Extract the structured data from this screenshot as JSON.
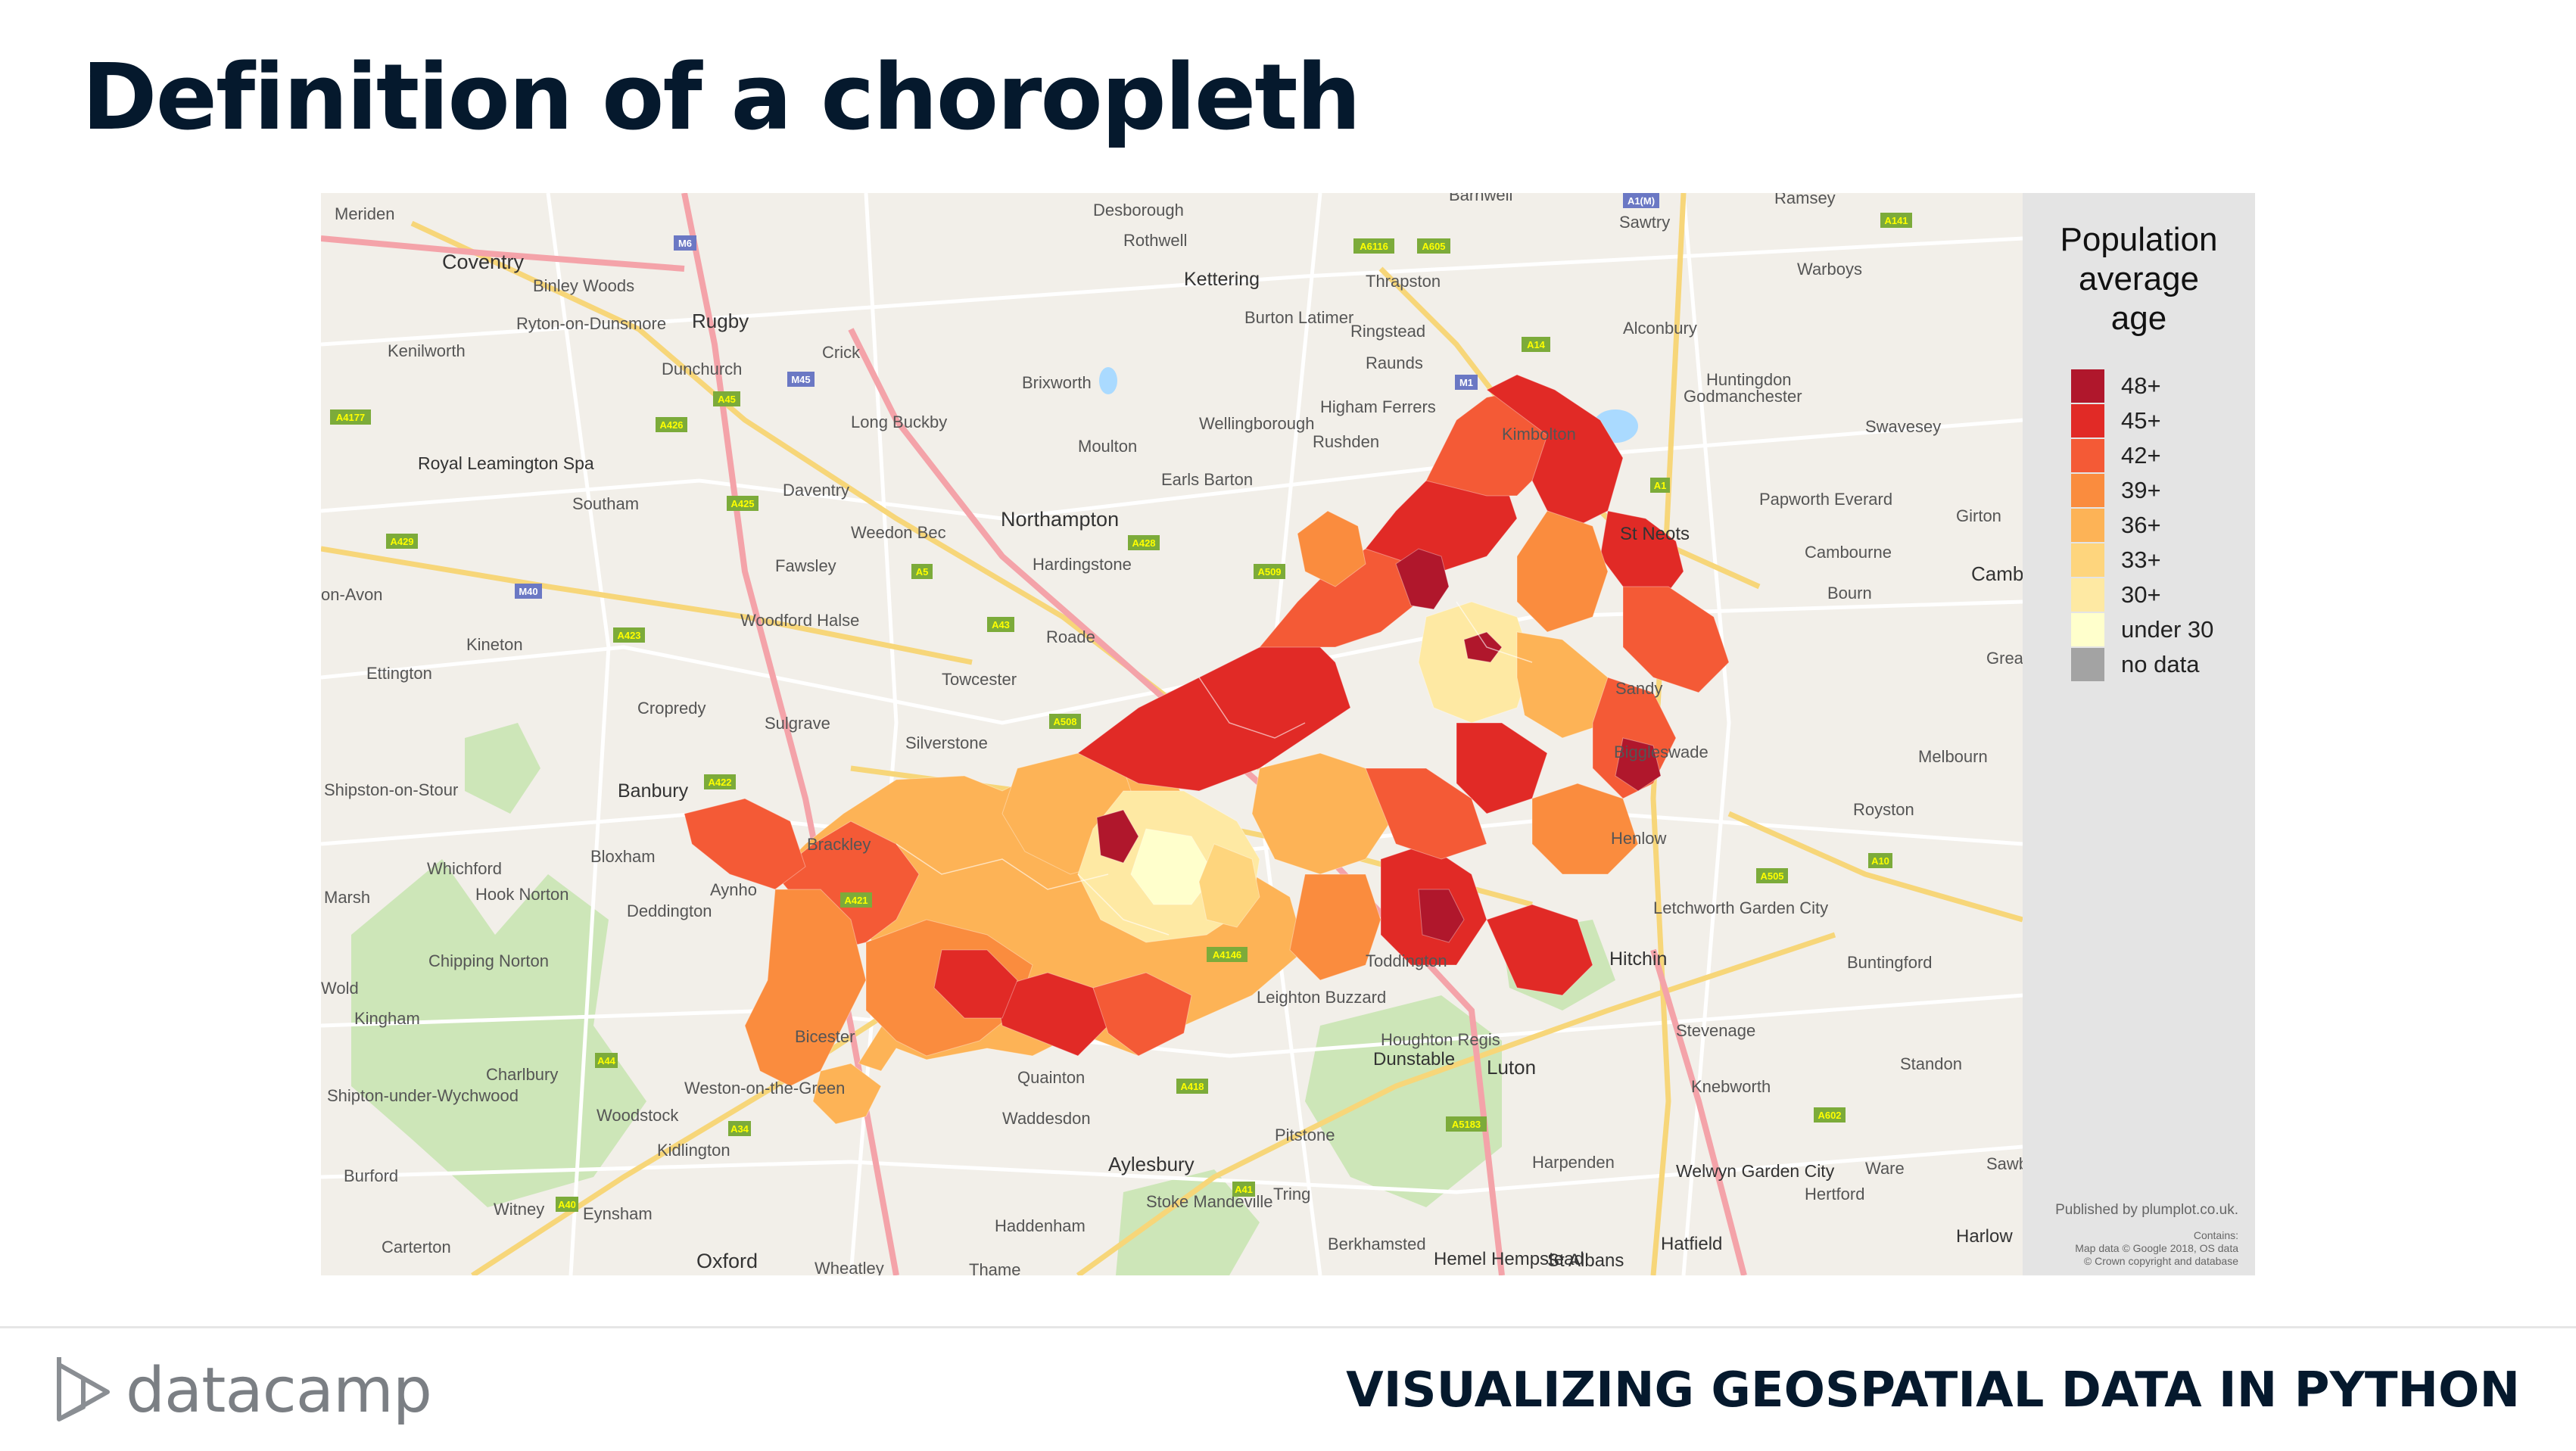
{
  "slide": {
    "title": "Definition of a choropleth"
  },
  "legend": {
    "title": "Population\naverage\nage",
    "items": [
      {
        "label": "48+",
        "color": "#b0172c"
      },
      {
        "label": "45+",
        "color": "#e12a26"
      },
      {
        "label": "42+",
        "color": "#f45a36"
      },
      {
        "label": "39+",
        "color": "#fa8c3e"
      },
      {
        "label": "36+",
        "color": "#fdb356"
      },
      {
        "label": "33+",
        "color": "#fed57d"
      },
      {
        "label": "30+",
        "color": "#fee9a3"
      },
      {
        "label": "under 30",
        "color": "#ffffcc"
      },
      {
        "label": "no data",
        "color": "#a3a3a3"
      }
    ]
  },
  "credits": {
    "published": "Published by plumplot.co.uk.",
    "contains": "Contains:",
    "map_data": "Map data © Google 2018, OS data",
    "copyright": "© Crown copyright and database"
  },
  "map": {
    "places": [
      "Meriden",
      "Coventry",
      "Binley Woods",
      "Ryton-on-Dunsmore",
      "Kenilworth",
      "Rugby",
      "Royal Leamington Spa",
      "Southam",
      "Dunchurch",
      "Crick",
      "Long Buckby",
      "Daventry",
      "Weedon Bec",
      "Fawsley",
      "Northampton",
      "Hardingstone",
      "Kettering",
      "Burton Latimer",
      "Desborough",
      "Rothwell",
      "Thrapston",
      "Ringstead",
      "Raunds",
      "Higham Ferrers",
      "Rushden",
      "Wellingborough",
      "Earls Barton",
      "Brixworth",
      "Moulton",
      "Kimbolton",
      "Barnwell",
      "Sawtry",
      "Ramsey",
      "Warboys",
      "Alconbury",
      "Huntingdon",
      "Godmanchester",
      "Swavesey",
      "Papworth Everard",
      "St Neots",
      "Cambourne",
      "Bourn",
      "Girton",
      "Camb",
      "Sandy",
      "Biggleswade",
      "Melbourn",
      "Royston",
      "Great",
      "Henlow",
      "Letchworth Garden City",
      "Hitchin",
      "Buntingford",
      "Stevenage",
      "Knebworth",
      "Standon",
      "Welwyn Garden City",
      "Hertford",
      "Ware",
      "Sawb",
      "Harlow",
      "Hatfield",
      "St Albans",
      "Hemel Hempstead",
      "Berkhamsted",
      "Luton",
      "Dunstable",
      "Houghton Regis",
      "Toddington",
      "Harpenden",
      "Leighton Buzzard",
      "Pitstone",
      "Tring",
      "Aylesbury",
      "Stoke Mandeville",
      "Haddenham",
      "Waddesdon",
      "Quainton",
      "Bicester",
      "Weston-on-the-Green",
      "Kidlington",
      "Woodstock",
      "Eynsham",
      "Witney",
      "Oxford",
      "Wheatley",
      "Thame",
      "Carterton",
      "Burford",
      "Charlbury",
      "Shipton-under-Wychwood",
      "Kingham",
      "Chipping Norton",
      "Hook Norton",
      "Whichford",
      "Deddington",
      "Aynho",
      "Bloxham",
      "Banbury",
      "Cropredy",
      "Sulgrave",
      "Silverstone",
      "Brackley",
      "Towcester",
      "Roade",
      "Woodford Halse",
      "Kineton",
      "Ettington",
      "Shipston-on-Stour",
      "on-Avon",
      "Marsh",
      "Wold"
    ],
    "roads": [
      "M6",
      "M45",
      "M40",
      "M1",
      "A1(M)",
      "A1",
      "A14",
      "A45",
      "A5",
      "A43",
      "A509",
      "A428",
      "A6116",
      "A605",
      "A508",
      "A423",
      "A422",
      "A421",
      "A4146",
      "A505",
      "A10",
      "A602",
      "A41",
      "A418",
      "A40",
      "A34",
      "A44",
      "A5183",
      "A4177",
      "A425",
      "A429",
      "A426",
      "A141"
    ]
  },
  "footer": {
    "brand": "datacamp",
    "course": "VISUALIZING GEOSPATIAL DATA IN PYTHON"
  }
}
